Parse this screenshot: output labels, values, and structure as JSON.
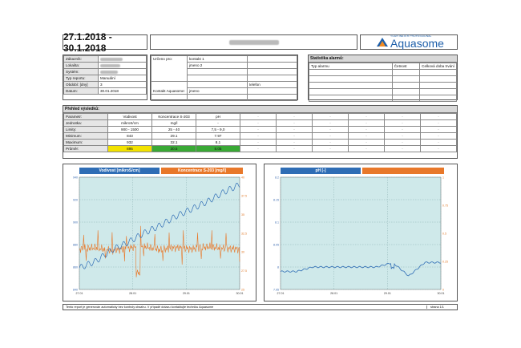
{
  "header": {
    "date_range": "27.1.2018 - 30.1.2018",
    "logo_small": "YOUR WATER PROFESSIONAL",
    "logo_name": "Aquasome"
  },
  "customer": {
    "rows": [
      {
        "label": "Zákazník:",
        "value": ""
      },
      {
        "label": "Lokalita:",
        "value": ""
      },
      {
        "label": "Systém:",
        "value": ""
      },
      {
        "label": "Typ reportu:",
        "value": "Manuální"
      },
      {
        "label": "Období: [dny]",
        "value": "3"
      },
      {
        "label": "Datum:",
        "value": "30.01.2018"
      }
    ]
  },
  "contacts": {
    "intended_label": "Určeno pro:",
    "contact1": "kontakt 1",
    "name2": "jmeno 2",
    "aquasome_label": "Kontakt Aquasome:",
    "aquasome_name": "jmeno",
    "phone": "telefon"
  },
  "alarms": {
    "title": "Statistika alarmů:",
    "col_type": "Typ alarmu",
    "col_count": "Četnost",
    "col_duration": "Celková doba trvání"
  },
  "overview": {
    "title": "Přehled výsledků:",
    "rows": [
      {
        "label": "Parametr:",
        "c1": "Vodivost",
        "c2": "Koncentrace S-203",
        "c3": "pH",
        "rest": [
          "-",
          "-",
          "-",
          "-",
          "-",
          "-"
        ]
      },
      {
        "label": "Jednotka:",
        "c1": "mikroS/cm",
        "c2": "mg/l",
        "c3": "-",
        "rest": [
          "-",
          "-",
          "-",
          "-",
          "-",
          "-"
        ]
      },
      {
        "label": "Limity:",
        "c1": "900 - 1500",
        "c2": "25 - 40",
        "c3": "7,5 - 9,0",
        "rest": [
          "-",
          "-",
          "-",
          "-",
          "-",
          "-"
        ]
      },
      {
        "label": "Minimum:",
        "c1": "843",
        "c2": "29.1",
        "c3": "7.97",
        "rest": [
          "-",
          "-",
          "-",
          "-",
          "-",
          "-"
        ]
      },
      {
        "label": "Maximum:",
        "c1": "932",
        "c2": "32.1",
        "c3": "8,1",
        "rest": [
          "-",
          "-",
          "-",
          "-",
          "-",
          "-"
        ]
      },
      {
        "label": "Průměr:",
        "c1": "895",
        "c2": "30.5",
        "c3": "8.05",
        "rest": [
          "-",
          "-",
          "-",
          "-",
          "-",
          "-"
        ]
      }
    ],
    "avg_colors": [
      "#f2e200",
      "#39a935",
      "#39a935"
    ]
  },
  "chart_data": [
    {
      "type": "line",
      "title": "",
      "series": [
        {
          "name": "Vodivost [mikroS/cm]",
          "color": "#2f6db5",
          "x": [
            "27.01",
            "27.09",
            "27.17",
            "28.01",
            "28.09",
            "28.17",
            "29.01",
            "29.09",
            "29.17",
            "30.01",
            "30.09"
          ],
          "values": [
            843,
            850,
            862,
            870,
            880,
            888,
            898,
            906,
            914,
            924,
            932
          ]
        },
        {
          "name": "Koncentrace S-203 [mg/l]",
          "color": "#e8782a",
          "x": [
            "27.01",
            "27.09",
            "27.17",
            "28.01",
            "28.09",
            "28.17",
            "29.01",
            "29.09",
            "29.17",
            "30.01",
            "30.09"
          ],
          "values": [
            30.4,
            30.6,
            30.2,
            30.5,
            30.8,
            30.3,
            30.6,
            30.4,
            30.7,
            30.5,
            30.4
          ]
        }
      ],
      "ylim_left": [
        820,
        940
      ],
      "ylim_right": [
        25,
        40
      ],
      "yticks_left": [
        "940",
        "920",
        "900",
        "880",
        "860",
        "840"
      ],
      "yticks_right": [
        "40",
        "37.5",
        "35",
        "32.5",
        "30",
        "27.5",
        "25"
      ],
      "xticks": [
        "27.01",
        "28.01",
        "29.01",
        "30.01"
      ],
      "grid": true
    },
    {
      "type": "line",
      "title": "",
      "series": [
        {
          "name": "pH [-]",
          "color": "#2f6db5",
          "x": [
            "27.01",
            "27.09",
            "27.17",
            "28.01",
            "28.09",
            "28.17",
            "29.01",
            "29.09",
            "29.17",
            "30.01",
            "30.09"
          ],
          "values": [
            7.99,
            7.99,
            8.0,
            8.0,
            8.0,
            8.0,
            8.0,
            8.01,
            7.98,
            8.01,
            8.01
          ]
        },
        {
          "name": "",
          "color": "#e8782a",
          "x": [],
          "values": []
        }
      ],
      "ylim_left": [
        7.95,
        8.2
      ],
      "ylim_right": [
        0,
        1
      ],
      "yticks_left": [
        "8.2",
        "8.15",
        "8.1",
        "8.05",
        "8",
        "7.95"
      ],
      "yticks_right": [
        "1",
        "0.75",
        "0.5",
        "0.25",
        "0"
      ],
      "xticks": [
        "27.01",
        "28.01",
        "29.01",
        "30.01"
      ],
      "grid": true
    }
  ],
  "footer": {
    "note": "Tento report je generován automaticky bez kontroly obsahu. V případě dotazu kontaktujte techniku Aquasome",
    "page": "strana 1/1"
  }
}
